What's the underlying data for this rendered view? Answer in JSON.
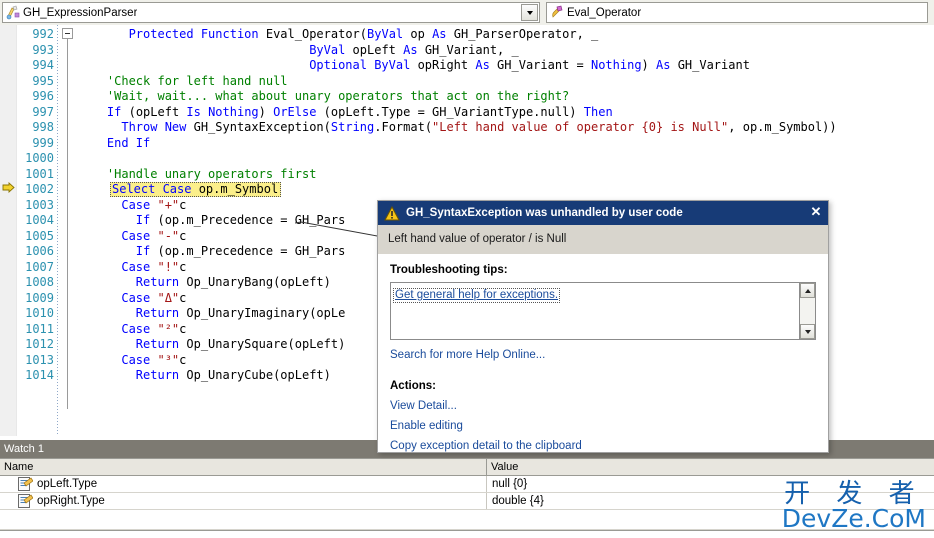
{
  "navbar": {
    "class_combo": {
      "value": "GH_ExpressionParser",
      "icon": "class-icon"
    },
    "member_combo": {
      "value": "Eval_Operator",
      "icon": "method-icon"
    },
    "dropdown_arrow_icon": "chevron-down-icon"
  },
  "editor": {
    "current_line_icon": "current-statement-arrow-icon",
    "fold_icon": "collapse-region-icon",
    "highlight_line_number": "1002",
    "highlight_text": "Select Case op.m_Symbol",
    "lines": [
      {
        "num": "992",
        "segments": [
          {
            "t": "       ",
            "c": "pl"
          },
          {
            "t": "Protected Function ",
            "c": "kw"
          },
          {
            "t": "Eval_Operator(",
            "c": "pl"
          },
          {
            "t": "ByVal ",
            "c": "kw"
          },
          {
            "t": "op ",
            "c": "pl"
          },
          {
            "t": "As ",
            "c": "kw"
          },
          {
            "t": "GH_ParserOperator, _",
            "c": "pl"
          }
        ]
      },
      {
        "num": "993",
        "segments": [
          {
            "t": "                                ",
            "c": "pl"
          },
          {
            "t": "ByVal ",
            "c": "kw"
          },
          {
            "t": "opLeft ",
            "c": "pl"
          },
          {
            "t": "As ",
            "c": "kw"
          },
          {
            "t": "GH_Variant, _",
            "c": "pl"
          }
        ]
      },
      {
        "num": "994",
        "segments": [
          {
            "t": "                                ",
            "c": "pl"
          },
          {
            "t": "Optional ByVal ",
            "c": "kw"
          },
          {
            "t": "opRight ",
            "c": "pl"
          },
          {
            "t": "As ",
            "c": "kw"
          },
          {
            "t": "GH_Variant = ",
            "c": "pl"
          },
          {
            "t": "Nothing",
            "c": "kw"
          },
          {
            "t": ") ",
            "c": "pl"
          },
          {
            "t": "As ",
            "c": "kw"
          },
          {
            "t": "GH_Variant",
            "c": "pl"
          }
        ]
      },
      {
        "num": "995",
        "segments": [
          {
            "t": "    'Check for left hand null",
            "c": "cm"
          }
        ]
      },
      {
        "num": "996",
        "segments": [
          {
            "t": "    'Wait, wait... what about unary operators that act on the right?",
            "c": "cm"
          }
        ]
      },
      {
        "num": "997",
        "segments": [
          {
            "t": "    ",
            "c": "pl"
          },
          {
            "t": "If ",
            "c": "kw"
          },
          {
            "t": "(opLeft ",
            "c": "pl"
          },
          {
            "t": "Is Nothing",
            "c": "kw"
          },
          {
            "t": ") ",
            "c": "pl"
          },
          {
            "t": "OrElse ",
            "c": "kw"
          },
          {
            "t": "(opLeft.Type = GH_VariantType.null) ",
            "c": "pl"
          },
          {
            "t": "Then",
            "c": "kw"
          }
        ]
      },
      {
        "num": "998",
        "segments": [
          {
            "t": "      ",
            "c": "pl"
          },
          {
            "t": "Throw New ",
            "c": "kw"
          },
          {
            "t": "GH_SyntaxException(",
            "c": "pl"
          },
          {
            "t": "String",
            "c": "kw"
          },
          {
            "t": ".Format(",
            "c": "pl"
          },
          {
            "t": "\"Left hand value of operator {0} is Null\"",
            "c": "st"
          },
          {
            "t": ", op.m_Symbol))",
            "c": "pl"
          }
        ]
      },
      {
        "num": "999",
        "segments": [
          {
            "t": "    ",
            "c": "pl"
          },
          {
            "t": "End If",
            "c": "kw"
          }
        ]
      },
      {
        "num": "1000",
        "segments": [
          {
            "t": "",
            "c": "pl"
          }
        ]
      },
      {
        "num": "1001",
        "segments": [
          {
            "t": "    'Handle unary operators first",
            "c": "cm"
          }
        ]
      },
      {
        "num": "1002",
        "segments": [
          {
            "t": "    ",
            "c": "pl"
          },
          {
            "t": "Select Case ",
            "c": "kw"
          },
          {
            "t": "op.m_Symbol",
            "c": "pl"
          }
        ],
        "highlight": true
      },
      {
        "num": "1003",
        "segments": [
          {
            "t": "      ",
            "c": "pl"
          },
          {
            "t": "Case ",
            "c": "kw"
          },
          {
            "t": "\"+\"",
            "c": "st"
          },
          {
            "t": "c",
            "c": "pl"
          }
        ]
      },
      {
        "num": "1004",
        "segments": [
          {
            "t": "        ",
            "c": "pl"
          },
          {
            "t": "If ",
            "c": "kw"
          },
          {
            "t": "(op.m_Precedence = GH_Pars",
            "c": "pl"
          }
        ]
      },
      {
        "num": "1005",
        "segments": [
          {
            "t": "      ",
            "c": "pl"
          },
          {
            "t": "Case ",
            "c": "kw"
          },
          {
            "t": "\"-\"",
            "c": "st"
          },
          {
            "t": "c",
            "c": "pl"
          }
        ]
      },
      {
        "num": "1006",
        "segments": [
          {
            "t": "        ",
            "c": "pl"
          },
          {
            "t": "If ",
            "c": "kw"
          },
          {
            "t": "(op.m_Precedence = GH_Pars",
            "c": "pl"
          }
        ]
      },
      {
        "num": "1007",
        "segments": [
          {
            "t": "      ",
            "c": "pl"
          },
          {
            "t": "Case ",
            "c": "kw"
          },
          {
            "t": "\"!\"",
            "c": "st"
          },
          {
            "t": "c",
            "c": "pl"
          }
        ]
      },
      {
        "num": "1008",
        "segments": [
          {
            "t": "        ",
            "c": "pl"
          },
          {
            "t": "Return ",
            "c": "kw"
          },
          {
            "t": "Op_UnaryBang(opLeft)",
            "c": "pl"
          }
        ]
      },
      {
        "num": "1009",
        "segments": [
          {
            "t": "      ",
            "c": "pl"
          },
          {
            "t": "Case ",
            "c": "kw"
          },
          {
            "t": "\"Δ\"",
            "c": "st"
          },
          {
            "t": "c",
            "c": "pl"
          }
        ]
      },
      {
        "num": "1010",
        "segments": [
          {
            "t": "        ",
            "c": "pl"
          },
          {
            "t": "Return ",
            "c": "kw"
          },
          {
            "t": "Op_UnaryImaginary(opLe",
            "c": "pl"
          }
        ]
      },
      {
        "num": "1011",
        "segments": [
          {
            "t": "      ",
            "c": "pl"
          },
          {
            "t": "Case ",
            "c": "kw"
          },
          {
            "t": "\"²\"",
            "c": "st"
          },
          {
            "t": "c",
            "c": "pl"
          }
        ]
      },
      {
        "num": "1012",
        "segments": [
          {
            "t": "        ",
            "c": "pl"
          },
          {
            "t": "Return ",
            "c": "kw"
          },
          {
            "t": "Op_UnarySquare(opLeft)",
            "c": "pl"
          }
        ]
      },
      {
        "num": "1013",
        "segments": [
          {
            "t": "      ",
            "c": "pl"
          },
          {
            "t": "Case ",
            "c": "kw"
          },
          {
            "t": "\"³\"",
            "c": "st"
          },
          {
            "t": "c",
            "c": "pl"
          }
        ]
      },
      {
        "num": "1014",
        "segments": [
          {
            "t": "        ",
            "c": "pl"
          },
          {
            "t": "Return ",
            "c": "kw"
          },
          {
            "t": "Op_UnaryCube(opLeft)",
            "c": "pl"
          }
        ]
      }
    ]
  },
  "exception_dialog": {
    "warning_icon": "warning-triangle-icon",
    "title": "GH_SyntaxException was unhandled by user code",
    "close_icon": "close-icon",
    "close_label": "✕",
    "message": "Left hand value of operator / is Null",
    "tips_heading": "Troubleshooting tips:",
    "tips": [
      "Get general help for exceptions."
    ],
    "scroll_up_icon": "scroll-up-arrow-icon",
    "scroll_down_icon": "scroll-down-arrow-icon",
    "search_online": "Search for more Help Online...",
    "actions_heading": "Actions:",
    "actions": [
      "View Detail...",
      "Enable editing",
      "Copy exception detail to the clipboard"
    ],
    "title_bar_color": "#173b77",
    "link_color": "#1a4b9b"
  },
  "watch_panel": {
    "tab_label": "Watch 1",
    "columns": [
      "Name",
      "Value"
    ],
    "rows": [
      {
        "icon": "watch-variable-icon",
        "name": "opLeft.Type",
        "value": "null {0}"
      },
      {
        "icon": "watch-variable-icon",
        "name": "opRight.Type",
        "value": "double {4}"
      }
    ]
  },
  "watermark": {
    "line1": "开 发 者",
    "line2": "DevZe.CoM",
    "color": "#1560ad"
  }
}
